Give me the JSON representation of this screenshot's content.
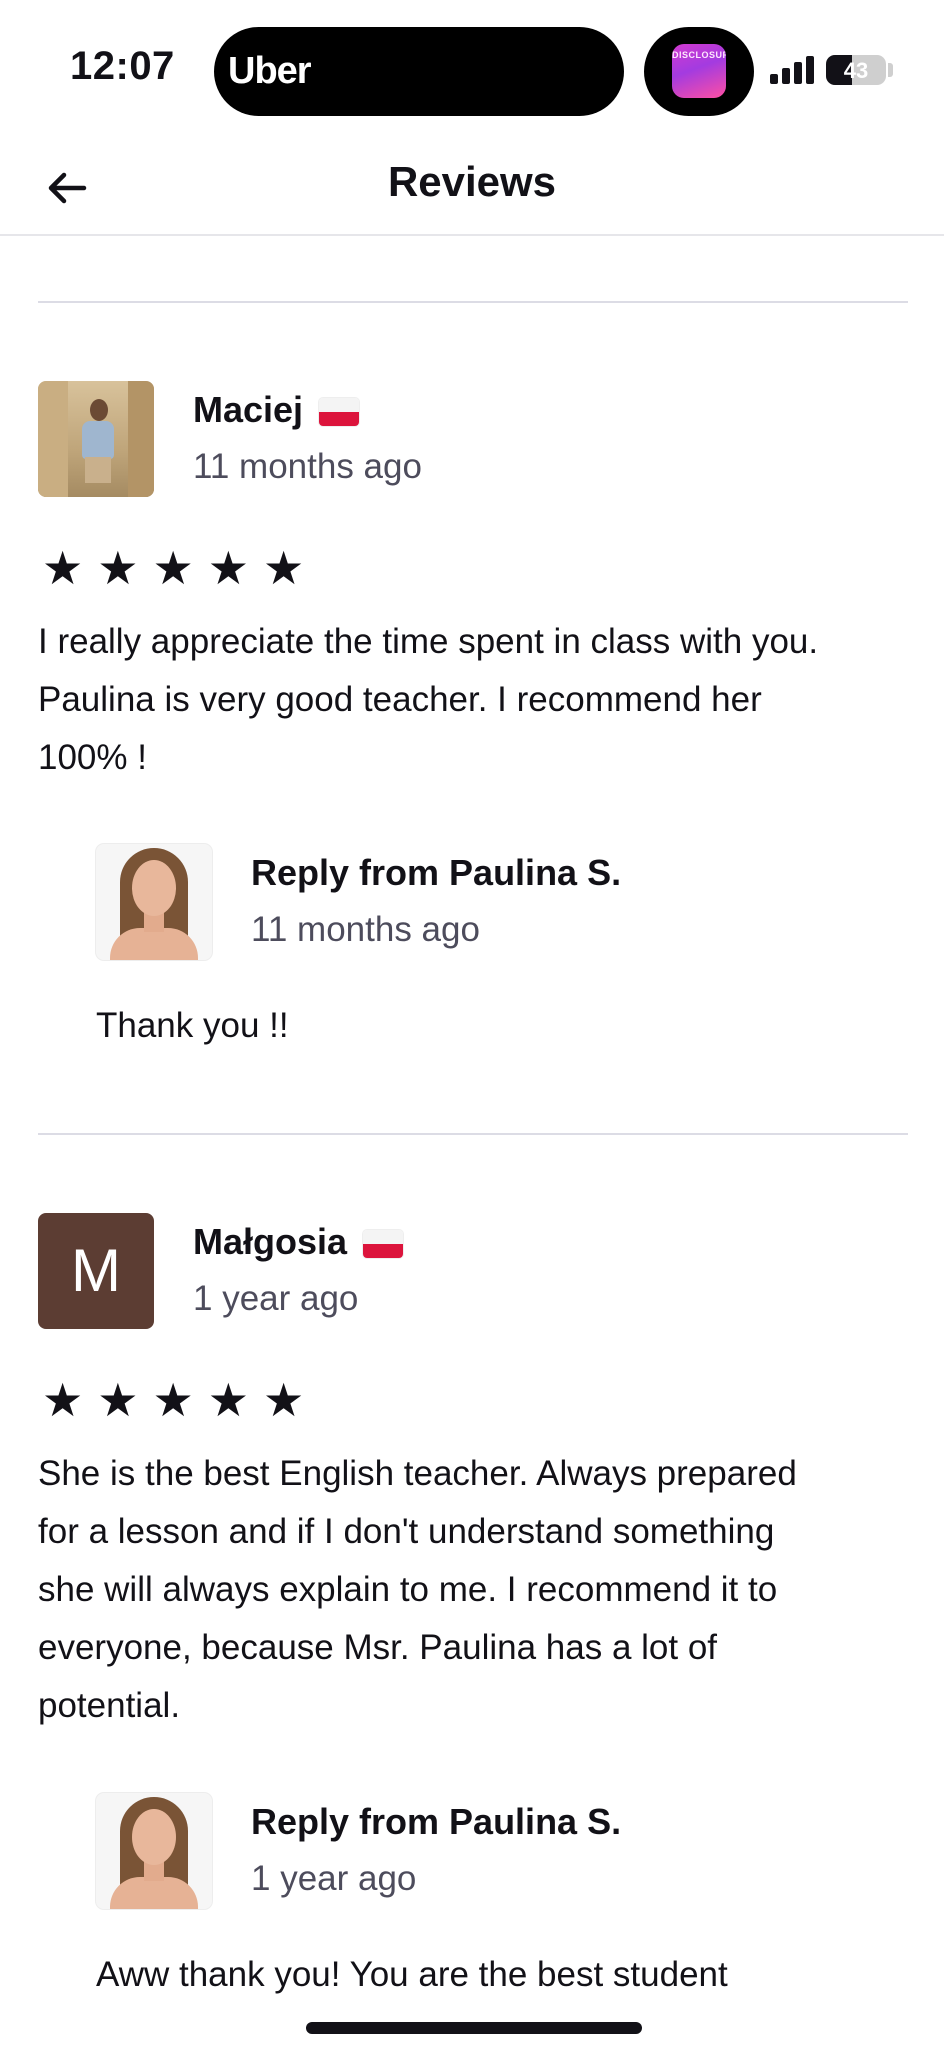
{
  "status_bar": {
    "time": "12:07",
    "live_activity_app": "Uber",
    "app_thumbnail_text": "DISCLOSURE",
    "battery_level": "43",
    "battery_percent": 43
  },
  "header": {
    "title": "Reviews"
  },
  "reviews": [
    {
      "reviewer": "Maciej",
      "flag": "poland-flag",
      "date": "11 months ago",
      "rating": 5,
      "stars": "★★★★★",
      "text_lines": [
        "I really appreciate the time spent in class with you.",
        "Paulina is very good teacher. I recommend her",
        "100% !"
      ],
      "reply": {
        "title": "Reply from Paulina S.",
        "date": "11 months ago",
        "text": "Thank you !!"
      }
    },
    {
      "reviewer": "Małgosia",
      "avatar_letter": "M",
      "avatar_color": "#5c3d33",
      "flag": "poland-flag",
      "date": "1 year ago",
      "rating": 5,
      "stars": "★★★★★",
      "text_lines": [
        "She is the best English teacher. Always prepared",
        "for a lesson and if I don't understand something",
        "she will always explain to me. I recommend it to",
        "everyone, because Msr. Paulina has a lot of",
        "potential."
      ],
      "reply": {
        "title": "Reply from Paulina S.",
        "date": "1 year ago",
        "text": "Aww thank you! You are the best student"
      }
    }
  ],
  "colors": {
    "text": "#121117",
    "secondary_text": "#4d4c5c",
    "divider": "#dcdce5"
  }
}
